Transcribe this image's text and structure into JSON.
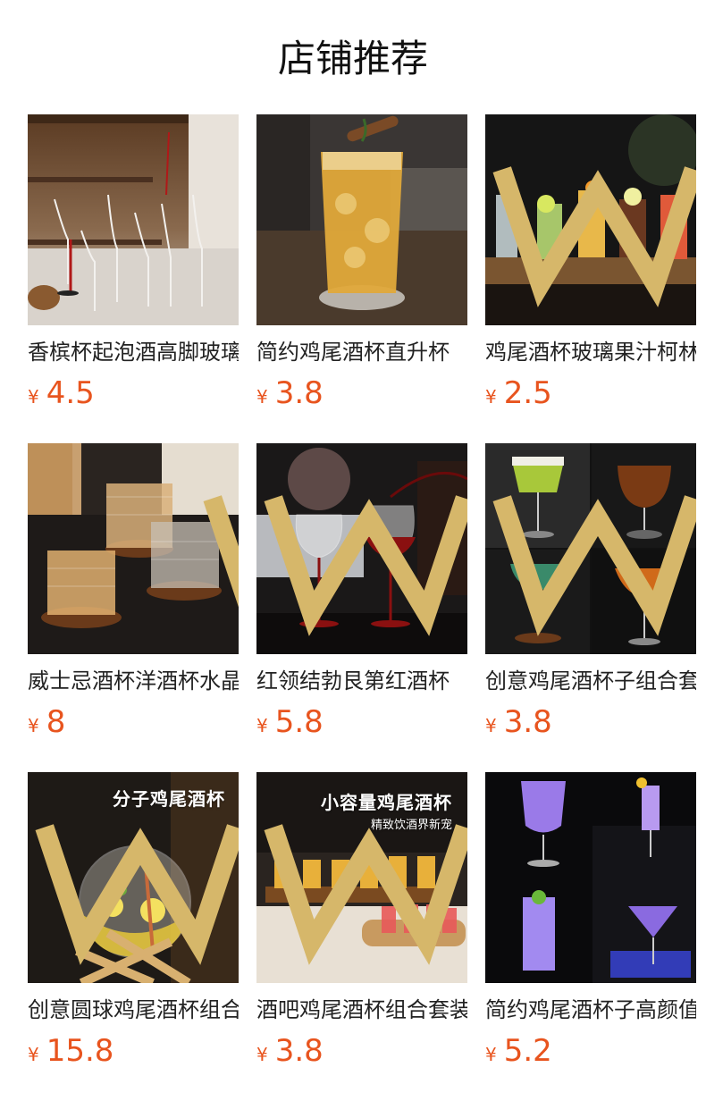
{
  "section": {
    "title": "店铺推荐"
  },
  "currency_symbol": "¥",
  "products": [
    {
      "name": "香槟杯起泡酒高脚玻璃杯",
      "price": "4.5",
      "image": "champagne-glasses-photo"
    },
    {
      "name": "简约鸡尾酒杯直升杯",
      "price": "3.8",
      "image": "iced-cocktail-photo"
    },
    {
      "name": "鸡尾酒杯玻璃果汁柯林杯",
      "price": "2.5",
      "image": "cocktail-row-photo"
    },
    {
      "name": "威士忌酒杯洋酒杯水晶杯",
      "price": "8",
      "image": "whisky-glasses-photo"
    },
    {
      "name": "红领结勃艮第红酒杯",
      "price": "5.8",
      "image": "burgundy-wine-glasses-photo"
    },
    {
      "name": "创意鸡尾酒杯子组合套装",
      "price": "3.8",
      "image": "four-cocktails-photo"
    },
    {
      "name": "创意圆球鸡尾酒杯组合",
      "price": "15.8",
      "image": "sphere-cocktail-photo",
      "overlay_title": "分子鸡尾酒杯"
    },
    {
      "name": "酒吧鸡尾酒杯组合套装",
      "price": "3.8",
      "image": "shot-glasses-photo",
      "overlay_title": "小容量鸡尾酒杯",
      "overlay_subtitle": "精致饮酒界新宠"
    },
    {
      "name": "简约鸡尾酒杯子高颜值",
      "price": "5.2",
      "image": "purple-cocktails-photo"
    }
  ]
}
